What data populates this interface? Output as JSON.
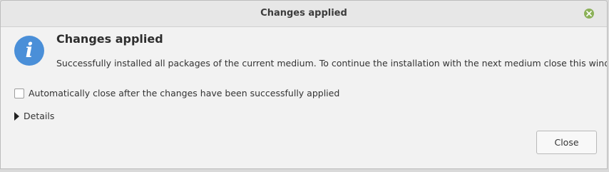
{
  "window": {
    "title": "Changes applied"
  },
  "dialog": {
    "heading": "Changes applied",
    "message": "Successfully installed all packages of the current medium. To continue the installation with the next medium close this window.",
    "auto_close_label": "Automatically close after the changes have been successfully applied",
    "auto_close_checked": false,
    "details_label": "Details",
    "close_button_label": "Close"
  },
  "icons": {
    "info": "info-icon",
    "window_close": "close-icon",
    "expander": "triangle-right-icon"
  },
  "colors": {
    "info_icon": "#4a8fd8",
    "window_close_button": "#8bb158"
  }
}
